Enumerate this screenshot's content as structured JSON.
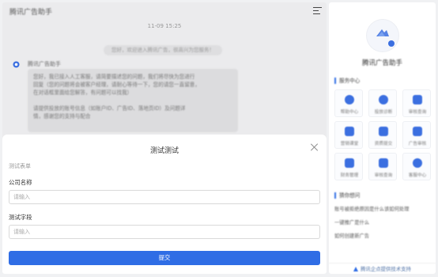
{
  "chat": {
    "title": "腾讯广告助手",
    "timestamp": "11-09 15:25",
    "welcome": "您好，欢迎进入腾讯广告，很高兴为您服务！",
    "bot_name": "腾讯广告助手",
    "bubble_lines": [
      "您好，我已接入人工客服，请简要描述您的问题，我们将尽快为您进行",
      "回复（您的问题将会被客户经理，请耐心等待一下，您的请您一直留意，",
      "在对话框里面给您解答，有问题可以找我）",
      "",
      "请提供投放的账号信息（如账户ID、广告ID、落地页ID）及问题详",
      "情，感谢您的支持与配合"
    ]
  },
  "dialog": {
    "title": "测试测试",
    "form_name": "测试表单",
    "fields": [
      {
        "label": "公司名称",
        "placeholder": "请输入"
      },
      {
        "label": "测试字段",
        "placeholder": "请输入"
      }
    ],
    "submit_label": "提交"
  },
  "panel": {
    "title": "腾讯广告助手",
    "services_heading": "服务中心",
    "services": [
      {
        "label": "帮助中心",
        "icon": "help-icon"
      },
      {
        "label": "投放诊断",
        "icon": "diagnosis-icon"
      },
      {
        "label": "审核查询",
        "icon": "review-icon"
      },
      {
        "label": "营销课堂",
        "icon": "classroom-icon"
      },
      {
        "label": "资质提交",
        "icon": "qualification-icon"
      },
      {
        "label": "广告审核",
        "icon": "ad-review-icon"
      },
      {
        "label": "财务管理",
        "icon": "finance-icon"
      },
      {
        "label": "审核查询",
        "icon": "search-review-icon"
      },
      {
        "label": "客服中心",
        "icon": "customer-service-icon"
      }
    ],
    "faq_heading": "猜你想问",
    "faq": [
      "账号被拒绝原因是什么该如何处理",
      "一键推广是什么",
      "如何创建新广告"
    ],
    "footer": "腾讯企点提供技术支持"
  },
  "colors": {
    "accent": "#2f6de5",
    "chat_bg": "#ebebed",
    "bubble": "#dcdcde"
  }
}
